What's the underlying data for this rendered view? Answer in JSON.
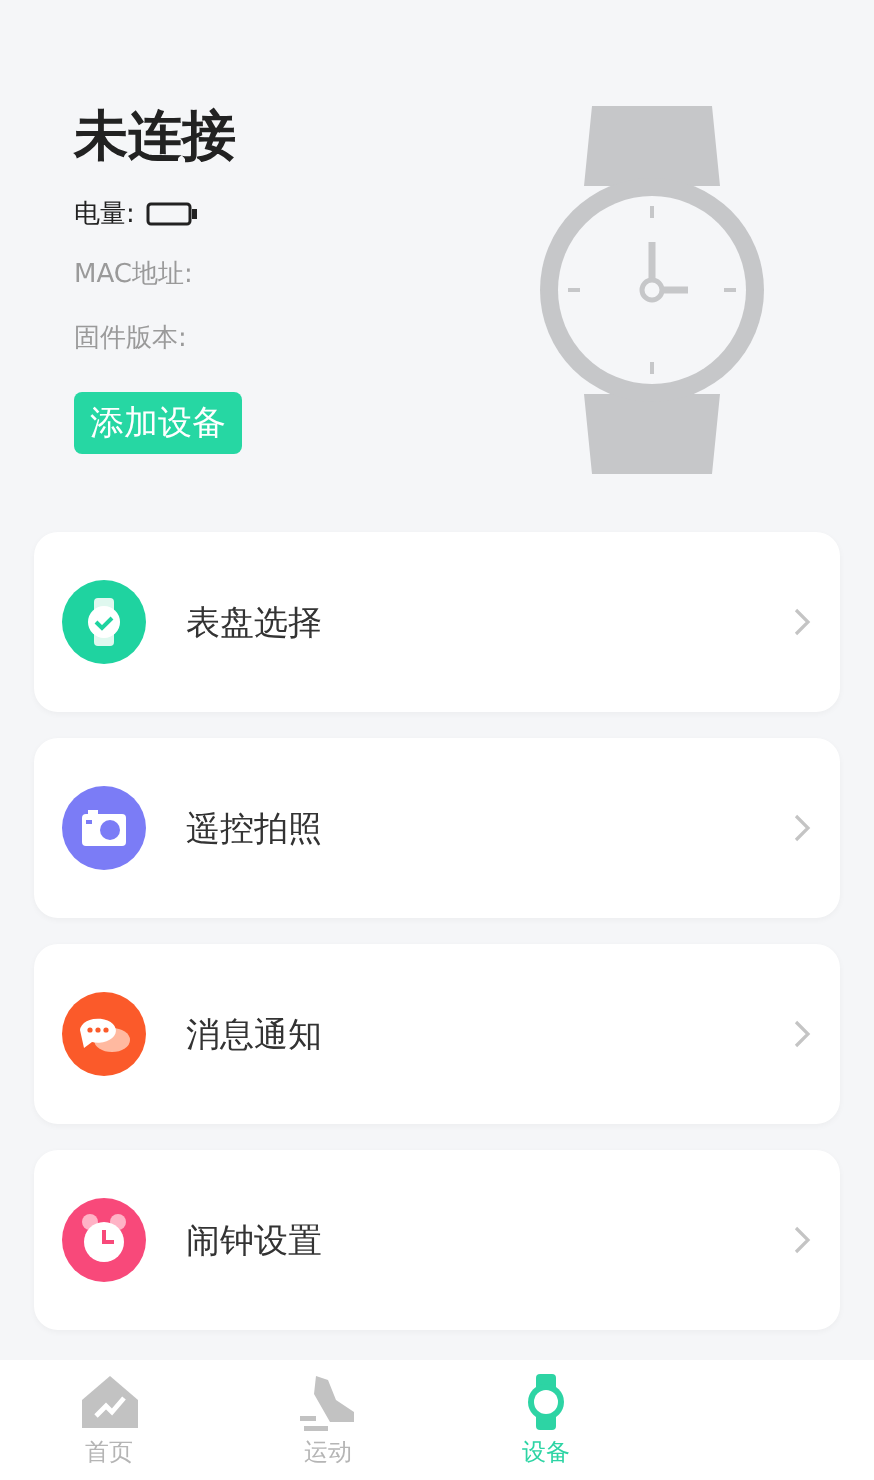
{
  "device": {
    "status": "未连接",
    "battery_label": "电量:",
    "mac_label": "MAC地址:",
    "firmware_label": "固件版本:",
    "add_button": "添加设备"
  },
  "menu": [
    {
      "kind": "watch",
      "label": "表盘选择",
      "color": "#1fd3a0"
    },
    {
      "kind": "camera",
      "label": "遥控拍照",
      "color": "#7b7cf6"
    },
    {
      "kind": "message",
      "label": "消息通知",
      "color": "#fb5a2a"
    },
    {
      "kind": "alarm",
      "label": "闹钟设置",
      "color": "#f8497a"
    }
  ],
  "tabs": [
    {
      "kind": "home",
      "label": "首页",
      "selected": false
    },
    {
      "kind": "sport",
      "label": "运动",
      "selected": false
    },
    {
      "kind": "device",
      "label": "设备",
      "selected": true
    }
  ]
}
